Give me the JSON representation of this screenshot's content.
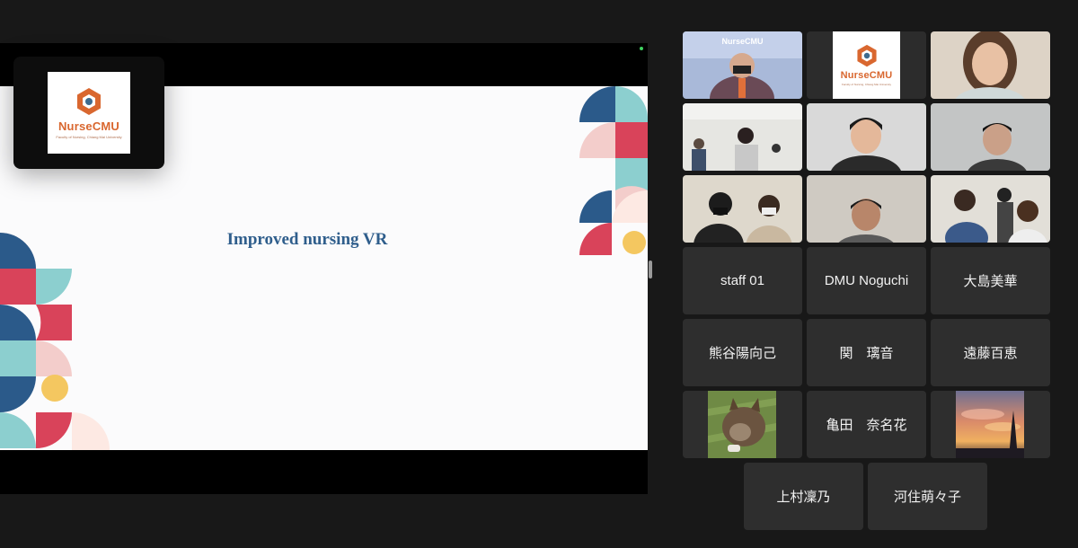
{
  "meeting": {
    "slide": {
      "title": "Improved nursing VR"
    },
    "self_view": {
      "logo_text": "NurseCMU",
      "logo_subtext": "Faculty of Nursing, Chiang Mai University"
    },
    "video_tiles": [
      {
        "type": "video",
        "label": "NurseCMU"
      },
      {
        "type": "logo",
        "label": "NurseCMU",
        "subtext": "Faculty of Nursing, Chiang Mai University"
      },
      {
        "type": "video"
      },
      {
        "type": "video"
      },
      {
        "type": "video",
        "active_speaker": true
      },
      {
        "type": "video"
      },
      {
        "type": "video"
      },
      {
        "type": "video"
      },
      {
        "type": "video"
      }
    ],
    "name_tiles": [
      {
        "name": "staff 01"
      },
      {
        "name": "DMU Noguchi"
      },
      {
        "name": "大島美華"
      },
      {
        "name": "熊谷陽向己"
      },
      {
        "name": "関　璃音"
      },
      {
        "name": "遠藤百恵"
      },
      {
        "name": "亀田　奈名花"
      },
      {
        "name": "上村凜乃"
      },
      {
        "name": "河住萌々子"
      }
    ],
    "image_tiles": [
      {
        "image": "cat-photo"
      },
      {
        "image": "sunset-photo"
      }
    ],
    "colors": {
      "background": "#181818",
      "tile": "#2e2e2e",
      "active_speaker_border": "#2fb344",
      "title": "#2f5e8c",
      "logo": "#d9672f"
    }
  }
}
